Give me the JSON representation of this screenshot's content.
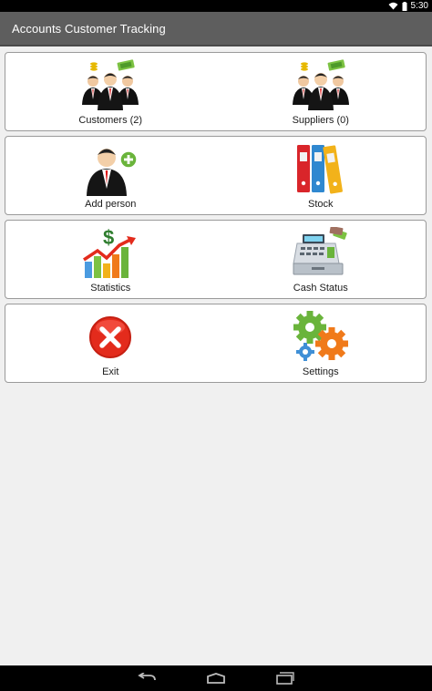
{
  "status_bar": {
    "time": "5:30",
    "wifi_icon": "wifi-icon",
    "battery_icon": "battery-icon"
  },
  "app": {
    "title": "Accounts Customer Tracking"
  },
  "menu": [
    {
      "left": {
        "label": "Customers (2)",
        "icon": "customers-icon"
      },
      "right": {
        "label": "Suppliers (0)",
        "icon": "suppliers-icon"
      }
    },
    {
      "left": {
        "label": "Add person",
        "icon": "add-person-icon"
      },
      "right": {
        "label": "Stock",
        "icon": "stock-icon"
      }
    },
    {
      "left": {
        "label": "Statistics",
        "icon": "statistics-icon"
      },
      "right": {
        "label": "Cash Status",
        "icon": "cash-register-icon"
      }
    },
    {
      "left": {
        "label": "Exit",
        "icon": "exit-icon"
      },
      "right": {
        "label": "Settings",
        "icon": "settings-icon"
      }
    }
  ],
  "nav_bar": {
    "back_icon": "back-icon",
    "home_icon": "home-icon",
    "recents_icon": "recents-icon"
  },
  "colors": {
    "action_bar": "#5e5e5e",
    "background": "#f0f0f0",
    "card": "#ffffff",
    "exit_red": "#e32b1c",
    "gear_green": "#6ab43b",
    "gear_orange": "#f07a1a",
    "gear_blue": "#3f8fd6"
  }
}
